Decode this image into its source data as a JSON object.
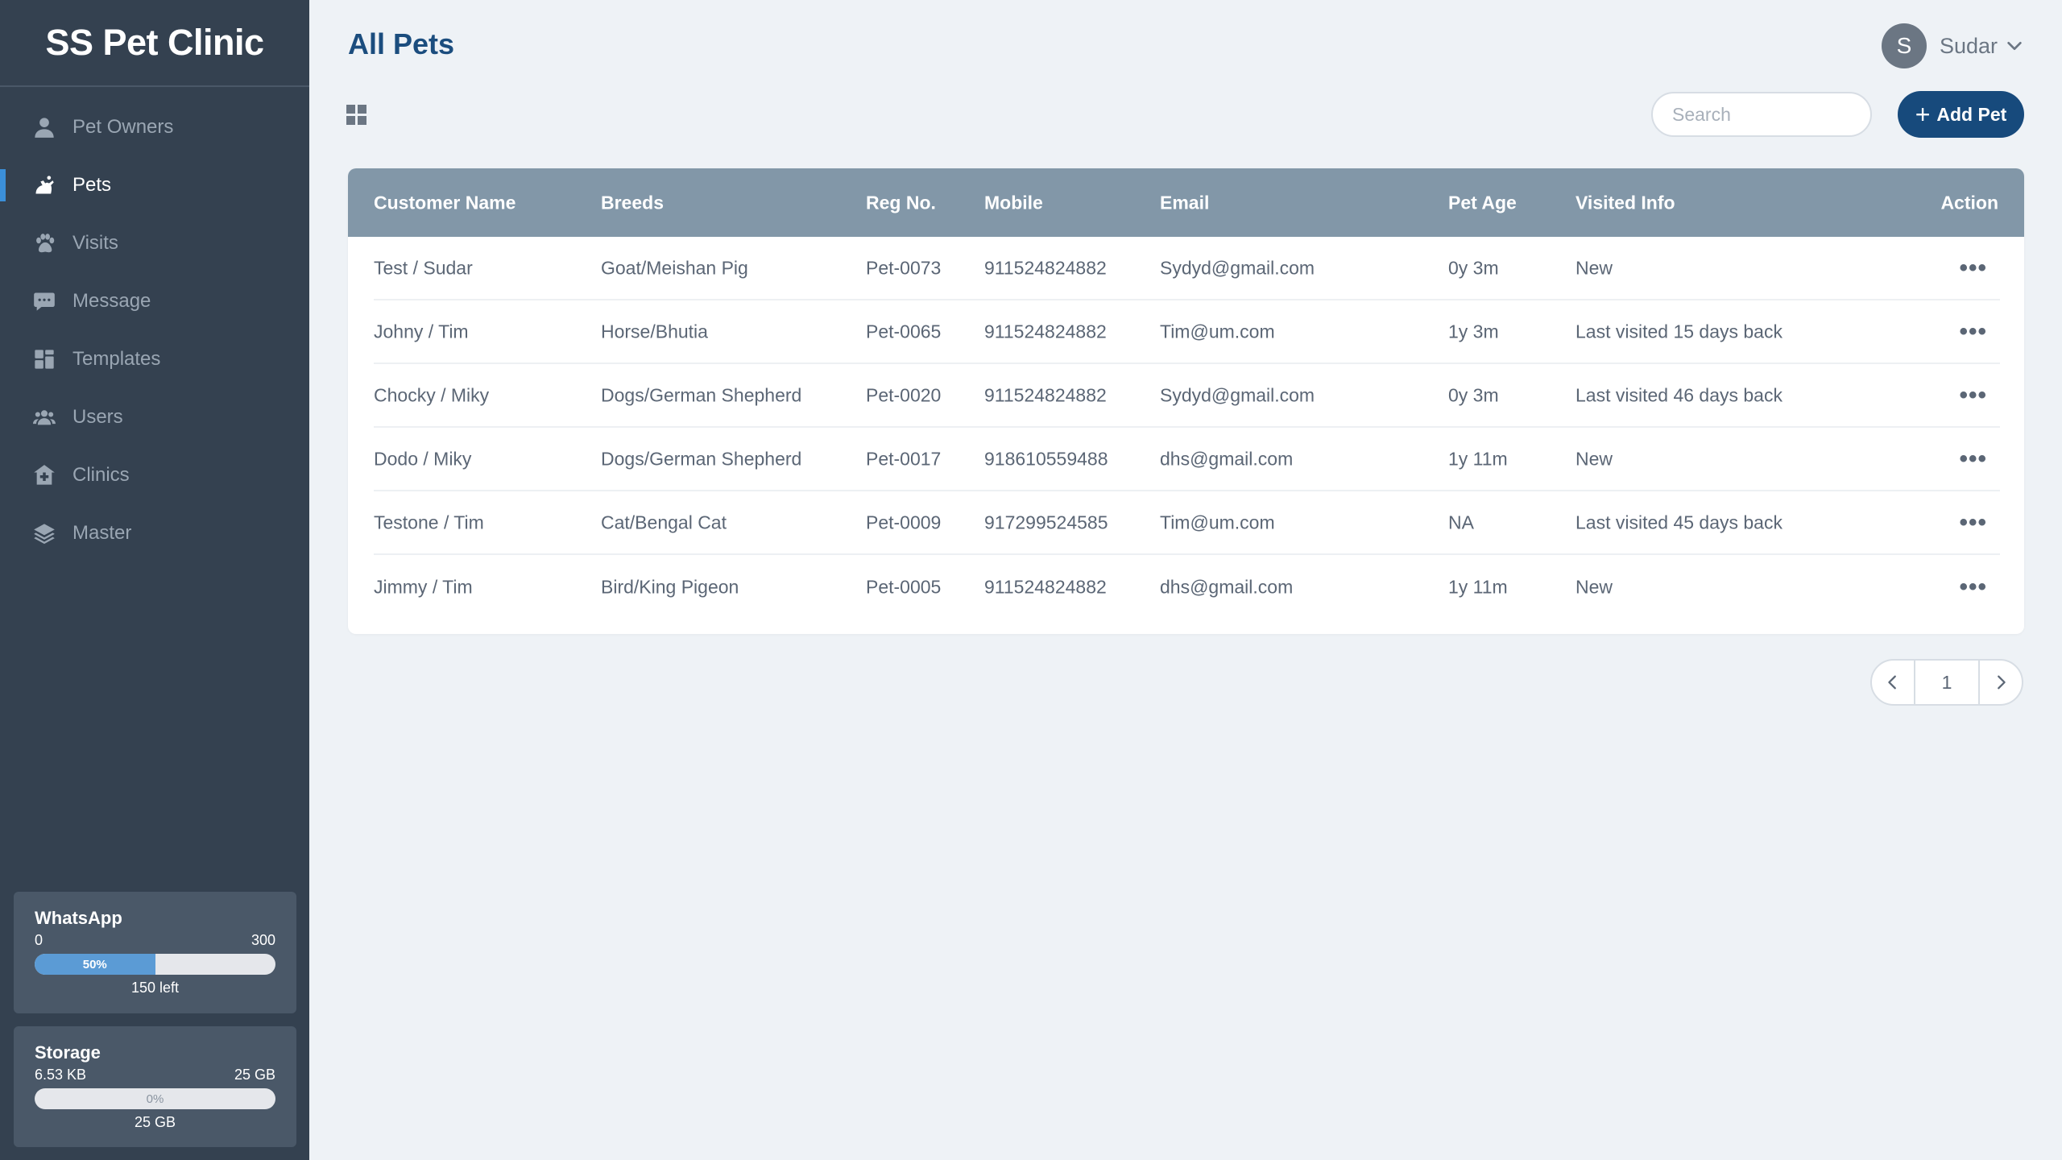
{
  "brand": "SS Pet Clinic",
  "nav": [
    {
      "label": "Pet Owners",
      "icon": "person-icon"
    },
    {
      "label": "Pets",
      "icon": "pet-icon",
      "active": true
    },
    {
      "label": "Visits",
      "icon": "paw-icon"
    },
    {
      "label": "Message",
      "icon": "chat-icon"
    },
    {
      "label": "Templates",
      "icon": "template-icon"
    },
    {
      "label": "Users",
      "icon": "users-icon"
    },
    {
      "label": "Clinics",
      "icon": "clinic-icon"
    },
    {
      "label": "Master",
      "icon": "layers-icon"
    }
  ],
  "whatsapp": {
    "title": "WhatsApp",
    "min": "0",
    "max": "300",
    "percent_label": "50%",
    "percent": 0.5,
    "left": "150 left"
  },
  "storage": {
    "title": "Storage",
    "used": "6.53 KB",
    "max": "25 GB",
    "percent_label": "0%",
    "percent": 0,
    "left": "25 GB"
  },
  "header": {
    "title": "All Pets",
    "user_initial": "S",
    "user_name": "Sudar"
  },
  "toolbar": {
    "search_placeholder": "Search",
    "add_label": "Add Pet"
  },
  "table": {
    "headers": {
      "customer": "Customer Name",
      "breeds": "Breeds",
      "reg": "Reg No.",
      "mobile": "Mobile",
      "email": "Email",
      "age": "Pet Age",
      "visited": "Visited Info",
      "action": "Action"
    },
    "rows": [
      {
        "customer": "Test / Sudar",
        "breeds": "Goat/Meishan Pig",
        "reg": "Pet-0073",
        "mobile": "911524824882",
        "email": "Sydyd@gmail.com",
        "age": "0y 3m",
        "visited": "New"
      },
      {
        "customer": "Johny / Tim",
        "breeds": "Horse/Bhutia",
        "reg": "Pet-0065",
        "mobile": "911524824882",
        "email": "Tim@um.com",
        "age": "1y 3m",
        "visited": "Last visited 15 days back"
      },
      {
        "customer": "Chocky / Miky",
        "breeds": "Dogs/German Shepherd",
        "reg": "Pet-0020",
        "mobile": "911524824882",
        "email": "Sydyd@gmail.com",
        "age": "0y 3m",
        "visited": "Last visited 46 days back"
      },
      {
        "customer": "Dodo / Miky",
        "breeds": "Dogs/German Shepherd",
        "reg": "Pet-0017",
        "mobile": "918610559488",
        "email": "dhs@gmail.com",
        "age": "1y 11m",
        "visited": "New"
      },
      {
        "customer": "Testone / Tim",
        "breeds": "Cat/Bengal Cat",
        "reg": "Pet-0009",
        "mobile": "917299524585",
        "email": "Tim@um.com",
        "age": "NA",
        "visited": "Last visited 45 days back"
      },
      {
        "customer": "Jimmy / Tim",
        "breeds": "Bird/King Pigeon",
        "reg": "Pet-0005",
        "mobile": "911524824882",
        "email": "dhs@gmail.com",
        "age": "1y 11m",
        "visited": "New"
      }
    ],
    "action_glyph": "•••"
  },
  "pagination": {
    "current": "1"
  }
}
